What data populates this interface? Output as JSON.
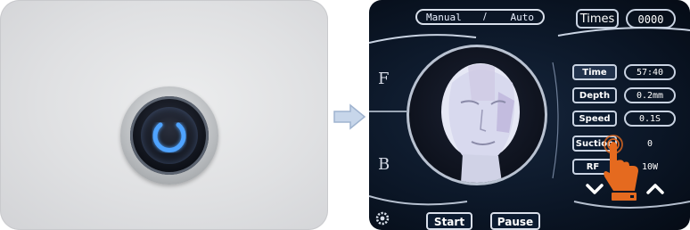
{
  "screen": {
    "mode": {
      "left": "Manual",
      "separator": "/",
      "right": "Auto"
    },
    "times": {
      "label": "Times",
      "value": "0000"
    },
    "sides": {
      "top": "F",
      "bottom": "B"
    },
    "params": [
      {
        "label": "Time",
        "value": "57:40",
        "selected": true
      },
      {
        "label": "Depth",
        "value": "0.2mm"
      },
      {
        "label": "Speed",
        "value": "0.1S"
      },
      {
        "label": "Suction",
        "value": "0"
      },
      {
        "label": "RF",
        "value": "10W"
      }
    ],
    "buttons": {
      "start": "Start",
      "pause": "Pause"
    }
  },
  "colors": {
    "power_glow": "#4fa3ff",
    "hand_icon": "#e56a1f",
    "screen_bg": "#0b1626"
  }
}
